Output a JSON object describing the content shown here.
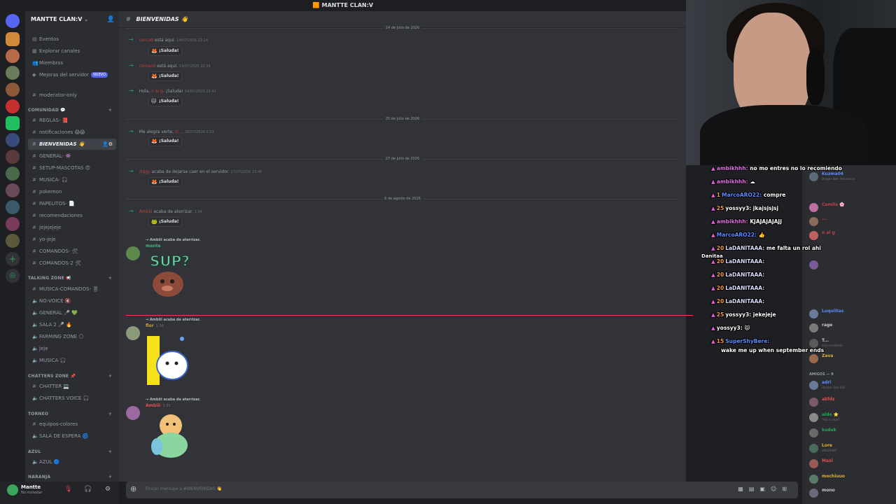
{
  "window": {
    "title": "MANTTE CLAN:V"
  },
  "server": {
    "name": "MANTTE CLAN:V"
  },
  "sidebar": {
    "top_items": [
      "Eventos",
      "Explorar canales",
      "Miembros",
      "Mejoras del servidor"
    ],
    "new_badge": "NUEVO",
    "channels_top": [
      "moderator-only"
    ],
    "categories": {
      "comunidad": "COMUNIDAD 💬",
      "talking_zone": "TALKING ZONE 📢",
      "chatters_zone": "CHATTERS ZONE 📌",
      "torneo": "TORNEO",
      "azul": "AZUL",
      "naranja": "NARANJA"
    },
    "comunidad_channels": [
      "REGLAS- 📕",
      "notificaciones 😱😱",
      "BIENVENIDAS 👋",
      "GENERAL- 👾",
      "SETUP-MASCOTAS 😍",
      "MUSICA- 🎧",
      "pokemon",
      "PAPELITOS- 📄",
      "recomendaciones",
      "jejejejeje",
      "yo-jeje",
      "COMANDOS- 🛠",
      "COMANDOS-2 🛠"
    ],
    "talking_channels": [
      "MUSICA-COMANDOS- 🎚",
      "NO-VOICE 🔇",
      "GENERAL 🎤 💚",
      "SALA 2 🎤 🔥",
      "FARMING ZONE 🌕",
      "jeje",
      "MUSICA 🎧"
    ],
    "chatters_channels": [
      "CHATTER 💻",
      "CHATTERS VOICE 🎧"
    ],
    "torneo_channels": [
      "equipos-colores",
      "SALA DE ESPERA 🌀"
    ],
    "azul_channels": [
      "AZUL 🔵"
    ]
  },
  "user_panel": {
    "name": "Mantte",
    "status": "No molestar"
  },
  "chat": {
    "channel": "BIENVENIDAS 👋",
    "wave_label": "¡Saluda!",
    "date_top": "14 de julio de 2026",
    "messages": [
      {
        "pre": "",
        "user": "cercod",
        "post": " está aquí.",
        "ts": "14/07/2026 22:14",
        "emo": "🦊"
      },
      {
        "pre": "",
        "user": "clonao0",
        "post": " está aquí.",
        "ts": "14/07/2026 22:39",
        "emo": "🦊"
      },
      {
        "pre": "Hola, ",
        "user": "n al g",
        "post": ". ¡Saluda!",
        "ts": "14/07/2026 22:42",
        "emo": "🐱"
      },
      {
        "pre": "Me alegra verte, ",
        "user": "O...",
        "post": ".",
        "ts": "26/07/2026 0:53",
        "emo": "🦊"
      },
      {
        "pre": "",
        "user": "ziggy",
        "post": " acaba de dejarse caer en el servidor.",
        "ts": "27/07/2026 23:46",
        "emo": "🦊"
      },
      {
        "pre": "",
        "user": "Ambiii",
        "post": " acaba de aterrizar.",
        "ts": "1:34",
        "emo": "🐸"
      }
    ],
    "date_seps": [
      "25 de julio de 2026",
      "27 de julio de 2026",
      "6 de agosto de 2026"
    ],
    "reply_text": "→ Ambiii acaba de aterrizar.",
    "big_msgs": [
      {
        "name": "mante",
        "ts": "",
        "sticker": "SUP?"
      },
      {
        "name": "flor",
        "ts": "1:34",
        "sticker": ""
      },
      {
        "name": "Ambiii",
        "ts": "1:35",
        "sticker": ""
      }
    ],
    "input_placeholder": "Enviar mensaje a #BIENVENIDAS 👋"
  },
  "overlay_chat": [
    {
      "name": "ambikhhh:",
      "text": " no mo entres no lo recomiendo",
      "cls": "nm-pink"
    },
    {
      "name": "ambikhhh:",
      "text": " ☁",
      "cls": "nm-pink"
    },
    {
      "name": "MarcoARO22:",
      "text": " compre",
      "cls": "nm-blue",
      "lvl": "1"
    },
    {
      "name": "yossyy3:",
      "text": " jkajsjsjsj",
      "cls": "nm-white",
      "lvl": "25"
    },
    {
      "name": "ambikhhh:",
      "text": " KJAJAJAJAJJ",
      "cls": "nm-pink"
    },
    {
      "name": "MarcoARO22:",
      "text": " 👍",
      "cls": "nm-blue"
    },
    {
      "name": "LaDANITAAA:",
      "text": " me falta un rol ahi",
      "cls": "nm-sub",
      "lvl": "20"
    },
    {
      "name": "LaDANITAAA:",
      "text": "",
      "cls": "nm-sub",
      "lvl": "20"
    },
    {
      "name": "LaDANITAAA:",
      "text": "",
      "cls": "nm-sub",
      "lvl": "20"
    },
    {
      "name": "LaDANITAAA:",
      "text": "",
      "cls": "nm-sub",
      "lvl": "20"
    },
    {
      "name": "LaDANITAAA:",
      "text": "",
      "cls": "nm-sub",
      "lvl": "20"
    },
    {
      "name": "yossyy3:",
      "text": " jekejeje",
      "cls": "nm-white",
      "lvl": "25"
    },
    {
      "name": "yossyy3:",
      "text": " 😾",
      "cls": "nm-white"
    },
    {
      "name": "SuperShyBere:",
      "text": "",
      "cls": "nm-blue",
      "lvl": "15"
    }
  ],
  "overlay_extra": "wake me up when september ends",
  "overlay_side_name": "Danitaa",
  "members": {
    "list": [
      {
        "name": "Kuzma04",
        "sub": "Dragon Ball: Xenoverse",
        "color": "#5c6a7a"
      },
      {
        "name": "Camila 🌸",
        "sub": "",
        "color": "#c070a0"
      },
      {
        "name": "...",
        "sub": "",
        "color": "#8a6a5a"
      },
      {
        "name": "n al g",
        "sub": "",
        "color": "#c06060"
      },
      {
        "name": "",
        "sub": "",
        "color": "#7a5a9a"
      },
      {
        "name": "Luquiitas",
        "sub": "",
        "color": "#6a7a9a"
      },
      {
        "name": "rage",
        "sub": "",
        "color": "#7a7a7a"
      },
      {
        "name": "T...",
        "sub": "lock.com/toxto",
        "color": "#5a5a5a"
      },
      {
        "name": "Zava",
        "sub": "",
        "color": "#9a6a4a"
      }
    ],
    "friends_header": "AMIGOS — 9",
    "friends": [
      {
        "name": "adri",
        "sub": "Honkai: Star Rail",
        "color": "#6a7a9a"
      },
      {
        "name": "akfdz",
        "sub": "",
        "color": "#7a5a6a"
      },
      {
        "name": "aldo ⭐",
        "sub": "\"Ala a virgin\"",
        "color": "#8a8a8a"
      },
      {
        "name": "kudok",
        "sub": "",
        "color": "#6a6a6a"
      },
      {
        "name": "Lore",
        "sub": "VALORANT",
        "color": "#4a6a5a"
      },
      {
        "name": "Maxi",
        "sub": "",
        "color": "#9a5a5a"
      },
      {
        "name": "mochiuuo",
        "sub": "",
        "color": "#5a7a6a"
      },
      {
        "name": "mono",
        "sub": "",
        "color": "#6a6a7a"
      }
    ]
  }
}
